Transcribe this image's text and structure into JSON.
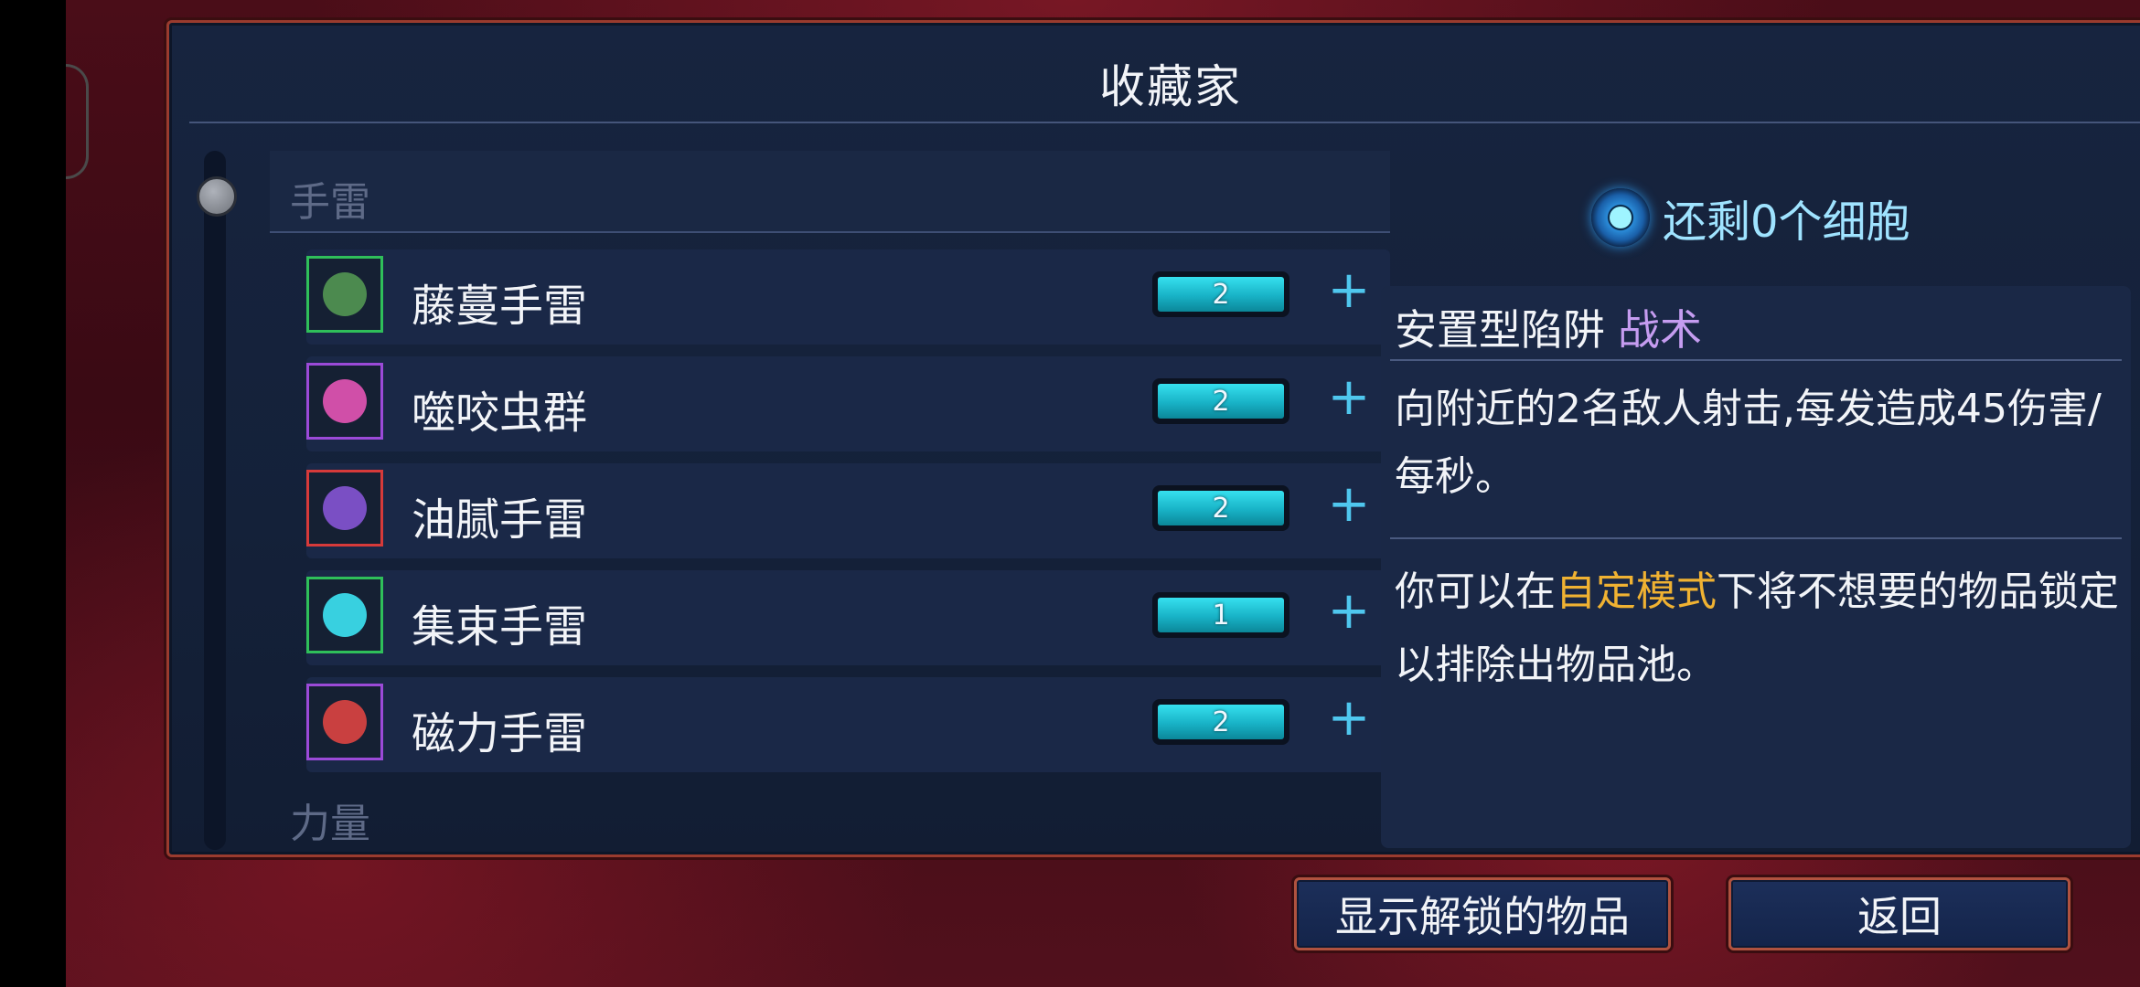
{
  "title": "收藏家",
  "categories": [
    "手雷",
    "力量"
  ],
  "items": [
    {
      "name": "藤蔓手雷",
      "level": "2",
      "icon": "vine-grenade-icon",
      "border_color": "#2fbf5a",
      "orb_color": "#4c8a4f"
    },
    {
      "name": "噬咬虫群",
      "level": "2",
      "icon": "biting-swarm-icon",
      "border_color": "#9b4ad8",
      "orb_color": "#d04fa8"
    },
    {
      "name": "油腻手雷",
      "level": "2",
      "icon": "oil-grenade-icon",
      "border_color": "#d63a3a",
      "orb_color": "#7a4fc4"
    },
    {
      "name": "集束手雷",
      "level": "1",
      "icon": "cluster-grenade-icon",
      "border_color": "#2fbf5a",
      "orb_color": "#38d0e0"
    },
    {
      "name": "磁力手雷",
      "level": "2",
      "icon": "magnetic-grenade-icon",
      "border_color": "#9b4ad8",
      "orb_color": "#c94040"
    }
  ],
  "plus_symbol": "+",
  "cells": {
    "text": "还剩0个细胞",
    "icon": "cell-icon"
  },
  "description": {
    "type": "安置型陷阱",
    "tag": "战术",
    "effect": "向附近的2名敌人射击,每发造成45伤害/每秒。",
    "hint_prefix": "你可以在",
    "hint_highlight": "自定模式",
    "hint_suffix": "下将不想要的物品锁定以排除出物品池。"
  },
  "buttons": {
    "show_unlocked": "显示解锁的物品",
    "back": "返回"
  },
  "colors": {
    "accent_cyan": "#4fc7ee",
    "tag_purple": "#c59cf0",
    "highlight_orange": "#f0b232",
    "frame_red": "#9a3b2e"
  }
}
